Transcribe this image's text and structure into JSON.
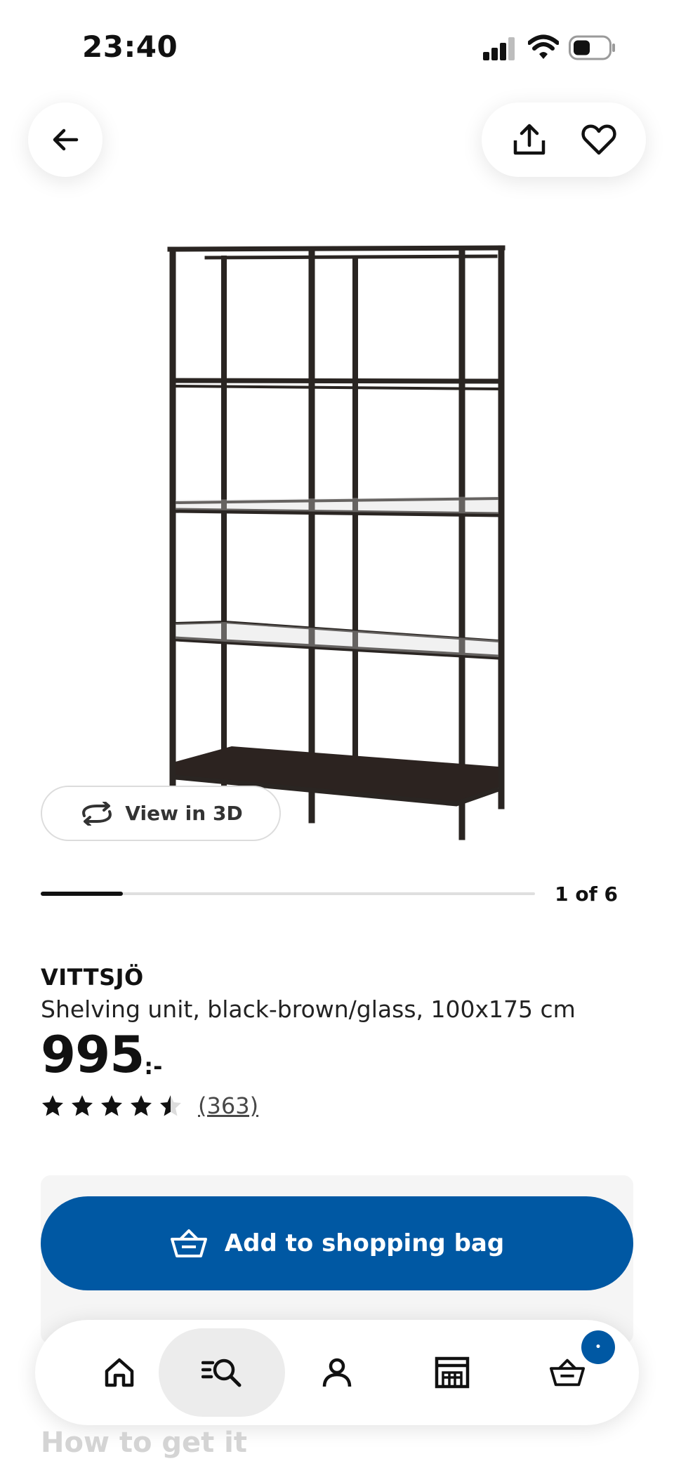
{
  "status_bar": {
    "time": "23:40",
    "icons": [
      "signal-icon",
      "wifi-icon",
      "battery-icon"
    ]
  },
  "header": {
    "back_icon": "arrow-left-icon",
    "actions": [
      "share-icon",
      "heart-icon"
    ]
  },
  "gallery": {
    "view_3d_label": "View in 3D",
    "counter": "1 of 6",
    "current": 1,
    "total": 6
  },
  "product": {
    "name": "VITTSJÖ",
    "description": "Shelving unit, black-brown/glass, 100x175 cm",
    "price_integer": "995",
    "price_suffix": ":-",
    "rating": 4.5,
    "rating_max": 5,
    "review_count": "(363)"
  },
  "buy": {
    "add_to_bag_label": "Add to shopping bag",
    "button_color": "#0058a3"
  },
  "bottom_nav": {
    "items": [
      "home-icon",
      "search-icon",
      "profile-icon",
      "store-icon",
      "cart-icon"
    ],
    "active": "search-icon",
    "cart_badge": "•"
  },
  "next_section": {
    "title": "How to get it"
  }
}
